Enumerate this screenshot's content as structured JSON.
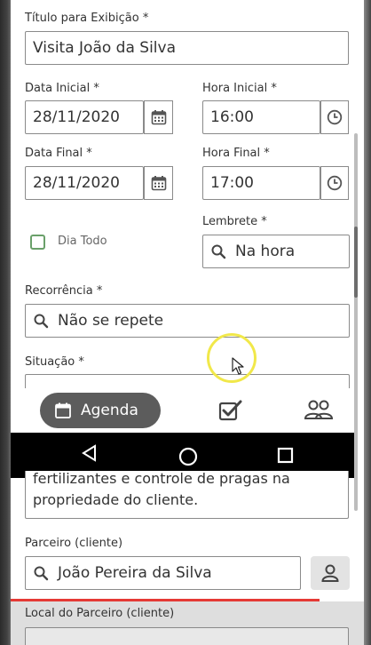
{
  "form": {
    "display_title_label": "Título para Exibição *",
    "display_title_value": "Visita João da Silva",
    "start_date_label": "Data Inicial *",
    "start_date_value": "28/11/2020",
    "start_time_label": "Hora Inicial *",
    "start_time_value": "16:00",
    "end_date_label": "Data Final *",
    "end_date_value": "28/11/2020",
    "end_time_label": "Hora Final *",
    "end_time_value": "17:00",
    "all_day_label": "Dia Todo",
    "all_day_checked": false,
    "reminder_label": "Lembrete *",
    "reminder_value": "Na hora",
    "recurrence_label": "Recorrência *",
    "recurrence_value": "Não se repete",
    "status_label": "Situação *",
    "description_line1": "fertilizantes e controle de pragas na",
    "description_line2": "propriedade do cliente.",
    "partner_label": "Parceiro (cliente)",
    "partner_value": "João Pereira da Silva",
    "partner_location_label": "Local do Parceiro (cliente)"
  },
  "bottom_nav": {
    "agenda_label": "Agenda",
    "items": [
      "calendar-icon",
      "checkbox-icon",
      "people-icon"
    ]
  },
  "system_nav": [
    "back-icon",
    "home-icon",
    "recents-icon"
  ],
  "colors": {
    "accent_pill": "#5c5c5c",
    "checkbox_border": "#6aa06a",
    "highlight_line": "#e53935",
    "cursor_ring": "#f1e84a"
  }
}
